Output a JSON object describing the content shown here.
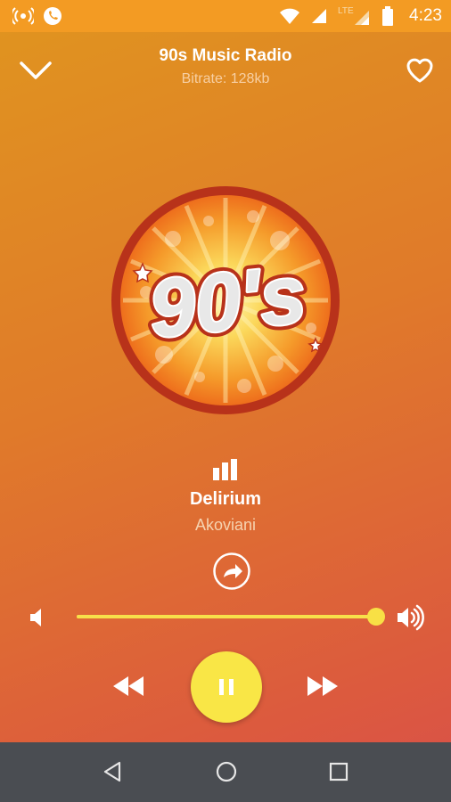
{
  "status_bar": {
    "time": "4:23",
    "network": "LTE",
    "icons": [
      "wireless-broadcast-icon",
      "phone-call-icon",
      "wifi-icon",
      "signal-icon",
      "lte-signal-icon",
      "battery-icon"
    ]
  },
  "header": {
    "title": "90s Music Radio",
    "subtitle": "Bitrate: 128kb",
    "left_icon": "chevron-down-icon",
    "right_icon": "heart-outline-icon"
  },
  "artwork": {
    "logo_text": "90's",
    "colors": {
      "ring": "#b8321a",
      "fill": "#f38a1f",
      "burst": "#fbd75a"
    }
  },
  "now_playing": {
    "song": "Delirium",
    "artist": "Akoviani"
  },
  "volume": {
    "level": 1.0
  },
  "controls": {
    "rewind_icon": "rewind-icon",
    "pause_icon": "pause-icon",
    "fast_forward_icon": "fast-forward-icon"
  },
  "colors": {
    "accent": "#f9e646",
    "status_bar": "#f39b23",
    "nav_bar": "#4a4d52"
  }
}
